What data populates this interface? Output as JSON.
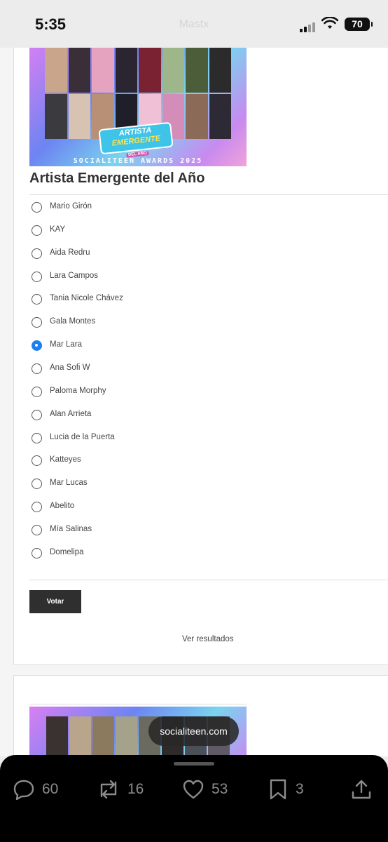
{
  "status_bar": {
    "time": "5:35",
    "url_ghost": "Mastx",
    "battery": "70"
  },
  "poll": {
    "banner": {
      "badge_top": "ARTISTA",
      "badge_mid": "EMERGENTE",
      "badge_sub": "DEL AÑO",
      "footer": "SOCIALITEEN AWARDS 2025"
    },
    "title": "Artista Emergente del Año",
    "options": [
      {
        "label": "Mario Girón",
        "checked": false
      },
      {
        "label": "KAY",
        "checked": false
      },
      {
        "label": "Aida Redru",
        "checked": false
      },
      {
        "label": "Lara Campos",
        "checked": false
      },
      {
        "label": "Tania Nicole Chávez",
        "checked": false
      },
      {
        "label": "Gala Montes",
        "checked": false
      },
      {
        "label": "Mar Lara",
        "checked": true
      },
      {
        "label": "Ana Sofi W",
        "checked": false
      },
      {
        "label": "Paloma Morphy",
        "checked": false
      },
      {
        "label": "Alan Arrieta",
        "checked": false
      },
      {
        "label": "Lucia de la Puerta",
        "checked": false
      },
      {
        "label": "Katteyes",
        "checked": false
      },
      {
        "label": "Mar Lucas",
        "checked": false
      },
      {
        "label": "Abelito",
        "checked": false
      },
      {
        "label": "Mía Salinas",
        "checked": false
      },
      {
        "label": "Domelipa",
        "checked": false
      }
    ],
    "vote_label": "Votar",
    "results_label": "Ver resultados"
  },
  "domain_pill": "socialiteen.com",
  "actions": {
    "replies": {
      "icon": "reply-icon",
      "count": "60"
    },
    "reposts": {
      "icon": "repost-icon",
      "count": "16"
    },
    "likes": {
      "icon": "heart-icon",
      "count": "53"
    },
    "bookmarks": {
      "icon": "bookmark-icon",
      "count": "3"
    },
    "share": {
      "icon": "share-icon"
    }
  },
  "colors": {
    "selected_radio": "#1d7ff0",
    "button_bg": "#2f2f2f",
    "bottom_bar": "#000000"
  }
}
